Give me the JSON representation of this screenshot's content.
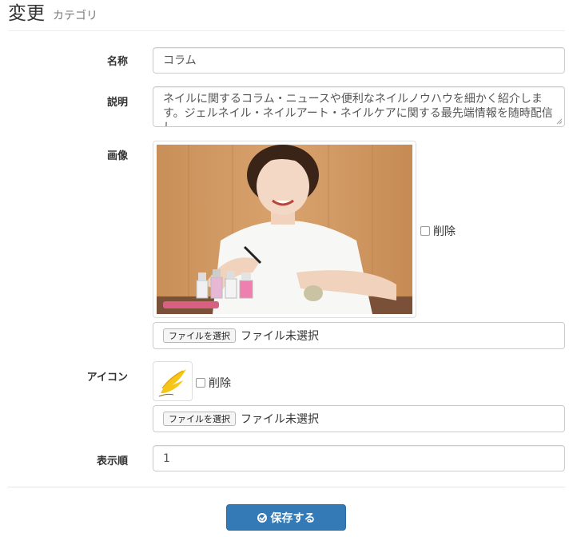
{
  "header": {
    "title": "変更",
    "subtitle": "カテゴリ"
  },
  "form": {
    "name": {
      "label": "名称",
      "value": "コラム"
    },
    "description": {
      "label": "説明",
      "value": "ネイルに関するコラム・ニュースや便利なネイルノウハウを細かく紹介します。ジェルネイル・ネイルアート・ネイルケアに関する最先端情報を随時配信し"
    },
    "image": {
      "label": "画像",
      "delete_label": "削除",
      "file_button": "ファイルを選択",
      "file_status": "ファイル未選択"
    },
    "icon": {
      "label": "アイコン",
      "delete_label": "削除",
      "file_button": "ファイルを選択",
      "file_status": "ファイル未選択"
    },
    "order": {
      "label": "表示順",
      "value": "1"
    }
  },
  "actions": {
    "save_label": "保存する"
  },
  "colors": {
    "primary": "#337ab7",
    "border": "#cccccc",
    "icon_yellow": "#f5c518"
  }
}
